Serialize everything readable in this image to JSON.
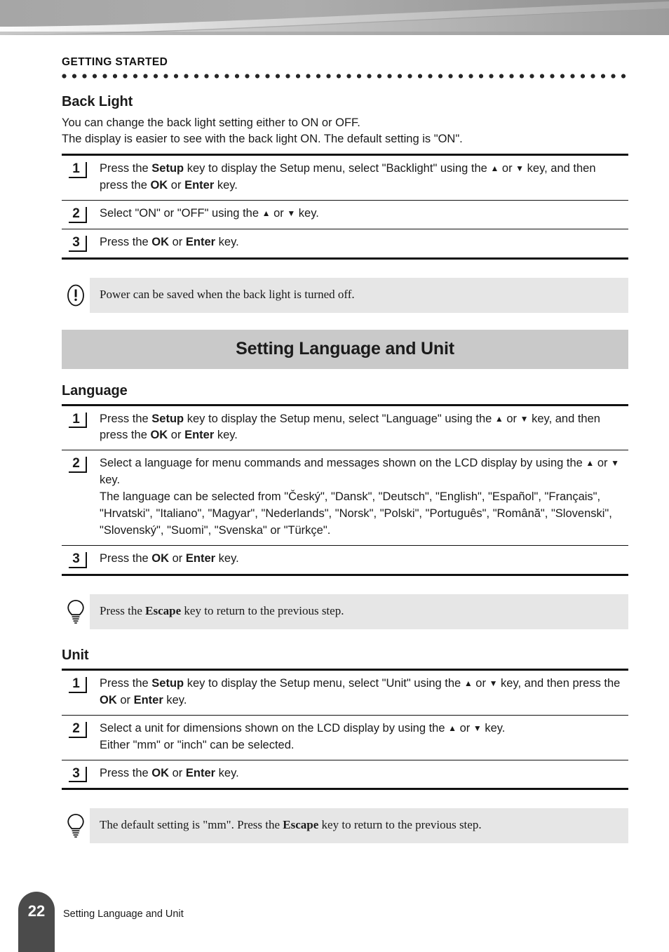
{
  "running_head": "GETTING STARTED",
  "backlight": {
    "heading": "Back Light",
    "intro_line1": "You can change the back light setting either to ON or OFF.",
    "intro_line2": "The display is easier to see with the back light ON. The default setting is \"ON\".",
    "steps": [
      {
        "number": "1",
        "parts": [
          {
            "t": "Press the ",
            "b": false
          },
          {
            "t": "Setup",
            "b": true
          },
          {
            "t": " key to display the Setup menu, select \"Backlight\" using the ",
            "b": false
          },
          {
            "t": "▲",
            "b": false,
            "icon": "up-triangle-icon"
          },
          {
            "t": " or ",
            "b": false
          },
          {
            "t": "▼",
            "b": false,
            "icon": "down-triangle-icon"
          },
          {
            "t": " key, and then press the ",
            "b": false
          },
          {
            "t": "OK",
            "b": true
          },
          {
            "t": " or ",
            "b": false
          },
          {
            "t": "Enter",
            "b": true
          },
          {
            "t": " key.",
            "b": false
          }
        ]
      },
      {
        "number": "2",
        "parts": [
          {
            "t": "Select \"ON\" or \"OFF\" using the ",
            "b": false
          },
          {
            "t": "▲",
            "b": false,
            "icon": "up-triangle-icon"
          },
          {
            "t": " or ",
            "b": false
          },
          {
            "t": "▼",
            "b": false,
            "icon": "down-triangle-icon"
          },
          {
            "t": " key.",
            "b": false
          }
        ]
      },
      {
        "number": "3",
        "parts": [
          {
            "t": "Press the ",
            "b": false
          },
          {
            "t": "OK",
            "b": true
          },
          {
            "t": " or ",
            "b": false
          },
          {
            "t": "Enter",
            "b": true
          },
          {
            "t": " key.",
            "b": false
          }
        ]
      }
    ],
    "note": {
      "icon": "exclamation-oval-icon",
      "parts": [
        {
          "t": "Power can be saved when the back light is turned off.",
          "b": false
        }
      ]
    }
  },
  "section_banner": "Setting Language and Unit",
  "language": {
    "heading": "Language",
    "steps": [
      {
        "number": "1",
        "parts": [
          {
            "t": "Press the ",
            "b": false
          },
          {
            "t": "Setup",
            "b": true
          },
          {
            "t": " key to display the Setup menu, select \"Language\" using the ",
            "b": false
          },
          {
            "t": "▲",
            "b": false,
            "icon": "up-triangle-icon"
          },
          {
            "t": " or ",
            "b": false
          },
          {
            "t": "▼",
            "b": false,
            "icon": "down-triangle-icon"
          },
          {
            "t": " key, and then press the ",
            "b": false
          },
          {
            "t": "OK",
            "b": true
          },
          {
            "t": " or ",
            "b": false
          },
          {
            "t": "Enter",
            "b": true
          },
          {
            "t": " key.",
            "b": false
          }
        ]
      },
      {
        "number": "2",
        "parts": [
          {
            "t": "Select a language for menu commands and messages shown on the LCD display by using the ",
            "b": false
          },
          {
            "t": "▲",
            "b": false,
            "icon": "up-triangle-icon"
          },
          {
            "t": " or ",
            "b": false
          },
          {
            "t": "▼",
            "b": false,
            "icon": "down-triangle-icon"
          },
          {
            "t": " key.",
            "b": false
          },
          {
            "t": "\n",
            "b": false,
            "break": true
          },
          {
            "t": "The language can be selected from \"Český\", \"Dansk\", \"Deutsch\", \"English\", \"Español\", \"Français\", \"Hrvatski\", \"Italiano\", \"Magyar\", \"Nederlands\", \"Norsk\", \"Polski\", \"Português\", \"Română\", \"Slovenski\", \"Slovenský\", \"Suomi\", \"Svenska\" or \"Türkçe\".",
            "b": false
          }
        ]
      },
      {
        "number": "3",
        "parts": [
          {
            "t": "Press the ",
            "b": false
          },
          {
            "t": "OK",
            "b": true
          },
          {
            "t": " or ",
            "b": false
          },
          {
            "t": "Enter",
            "b": true
          },
          {
            "t": " key.",
            "b": false
          }
        ]
      }
    ],
    "tip": {
      "icon": "lightbulb-icon",
      "parts": [
        {
          "t": "Press the ",
          "b": false
        },
        {
          "t": "Escape",
          "b": true
        },
        {
          "t": " key to return to the previous step.",
          "b": false
        }
      ]
    },
    "languages_list": [
      "Český",
      "Dansk",
      "Deutsch",
      "English",
      "Español",
      "Français",
      "Hrvatski",
      "Italiano",
      "Magyar",
      "Nederlands",
      "Norsk",
      "Polski",
      "Português",
      "Română",
      "Slovenski",
      "Slovenský",
      "Suomi",
      "Svenska",
      "Türkçe"
    ]
  },
  "unit": {
    "heading": "Unit",
    "steps": [
      {
        "number": "1",
        "parts": [
          {
            "t": "Press the ",
            "b": false
          },
          {
            "t": "Setup",
            "b": true
          },
          {
            "t": " key to display the Setup menu, select \"Unit\" using the ",
            "b": false
          },
          {
            "t": "▲",
            "b": false,
            "icon": "up-triangle-icon"
          },
          {
            "t": " or ",
            "b": false
          },
          {
            "t": "▼",
            "b": false,
            "icon": "down-triangle-icon"
          },
          {
            "t": " key, and then press the ",
            "b": false
          },
          {
            "t": "OK",
            "b": true
          },
          {
            "t": " or ",
            "b": false
          },
          {
            "t": "Enter",
            "b": true
          },
          {
            "t": " key.",
            "b": false
          }
        ]
      },
      {
        "number": "2",
        "parts": [
          {
            "t": "Select a unit for dimensions shown on the LCD display by using the ",
            "b": false
          },
          {
            "t": "▲",
            "b": false,
            "icon": "up-triangle-icon"
          },
          {
            "t": " or ",
            "b": false
          },
          {
            "t": "▼",
            "b": false,
            "icon": "down-triangle-icon"
          },
          {
            "t": " key.",
            "b": false
          },
          {
            "t": "\n",
            "b": false,
            "break": true
          },
          {
            "t": "Either \"mm\" or \"inch\" can be selected.",
            "b": false
          }
        ]
      },
      {
        "number": "3",
        "parts": [
          {
            "t": "Press the ",
            "b": false
          },
          {
            "t": "OK",
            "b": true
          },
          {
            "t": " or ",
            "b": false
          },
          {
            "t": "Enter",
            "b": true
          },
          {
            "t": " key.",
            "b": false
          }
        ]
      }
    ],
    "tip": {
      "icon": "lightbulb-icon",
      "parts": [
        {
          "t": "The default setting is \"mm\". Press the ",
          "b": false
        },
        {
          "t": "Escape",
          "b": true
        },
        {
          "t": " key to return to the previous step.",
          "b": false
        }
      ]
    },
    "options": [
      "mm",
      "inch"
    ]
  },
  "footer": {
    "page_number": "22",
    "label": "Setting Language and Unit"
  },
  "colors": {
    "banner_gray": "#9b9b9b",
    "section_banner": "#c9c9c9",
    "callout_bg": "#e6e6e6",
    "page_tab": "#4b4b4b",
    "rule": "#111111"
  }
}
